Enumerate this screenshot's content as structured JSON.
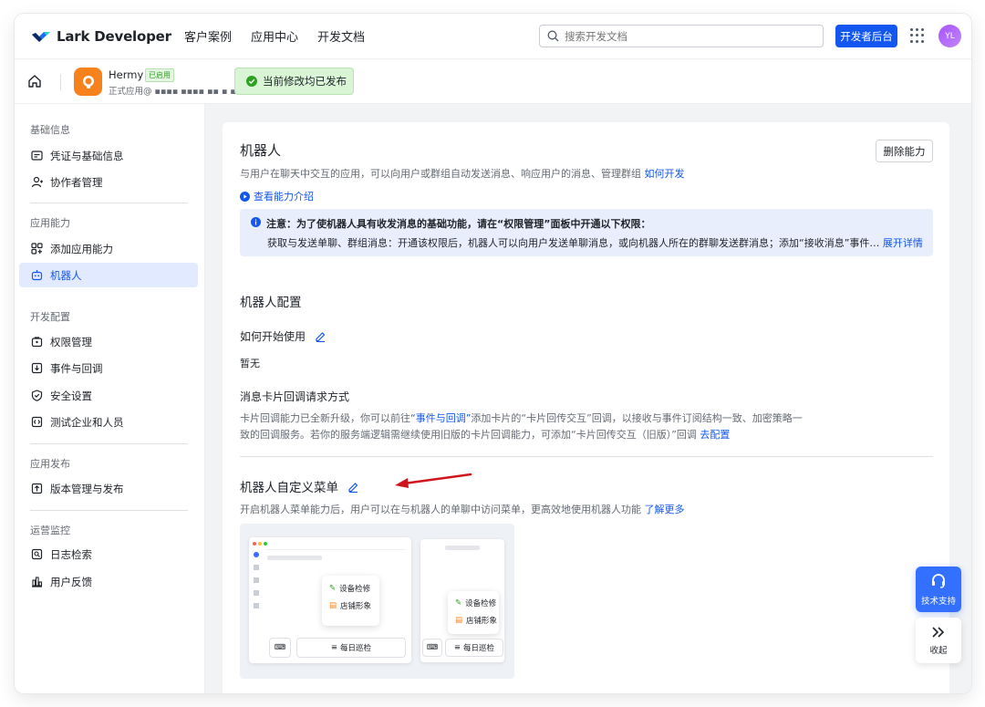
{
  "header": {
    "logo_text": "Lark Developer",
    "nav": [
      "客户案例",
      "应用中心",
      "开发文档"
    ],
    "search_placeholder": "搜索开发文档",
    "dev_console_label": "开发者后台",
    "avatar_initials": "YL"
  },
  "appbar": {
    "app_name": "Hermy",
    "app_status_badge": "已启用",
    "app_subtitle": "正式应用@ ▪▪▪▪ ▪▪▪▪ ▪▪ ▪ ▪▪",
    "publish_status": "当前修改均已发布"
  },
  "sidebar": {
    "sections": [
      {
        "title": "基础信息",
        "items": [
          {
            "label": "凭证与基础信息",
            "icon": "id-card-icon"
          },
          {
            "label": "协作者管理",
            "icon": "user-add-icon"
          }
        ]
      },
      {
        "title": "应用能力",
        "items": [
          {
            "label": "添加应用能力",
            "icon": "add-app-icon"
          },
          {
            "label": "机器人",
            "icon": "robot-icon",
            "active": true
          }
        ]
      },
      {
        "title": "开发配置",
        "items": [
          {
            "label": "权限管理",
            "icon": "permission-icon"
          },
          {
            "label": "事件与回调",
            "icon": "event-icon"
          },
          {
            "label": "安全设置",
            "icon": "shield-icon"
          },
          {
            "label": "测试企业和人员",
            "icon": "test-icon"
          }
        ]
      },
      {
        "title": "应用发布",
        "items": [
          {
            "label": "版本管理与发布",
            "icon": "upload-icon"
          }
        ]
      },
      {
        "title": "运营监控",
        "items": [
          {
            "label": "日志检索",
            "icon": "log-search-icon"
          },
          {
            "label": "用户反馈",
            "icon": "feedback-icon"
          }
        ]
      }
    ]
  },
  "main": {
    "title": "机器人",
    "delete_button": "删除能力",
    "description": "与用户在聊天中交互的应用，可以向用户或群组自动发送消息、响应用户的消息、管理群组",
    "how_to_dev_link": "如何开发",
    "intro_link": "查看能力介绍",
    "notice": {
      "title": "注意：为了使机器人具有收发消息的基础功能，请在“权限管理”面板中开通以下权限：",
      "body": "获取与发送单聊、群组消息：开通该权限后，机器人可以向用户发送单聊消息，或向机器人所在的群聊发送群消息；添加“接收消息”事件…",
      "expand_link": "展开详情"
    },
    "config_title": "机器人配置",
    "how_to_start_title": "如何开始使用",
    "how_to_start_value": "暂无",
    "card_callback_title": "消息卡片回调请求方式",
    "card_callback_line1_a": "卡片回调能力已全新升级，你可以前往",
    "card_callback_line1_link": "“事件与回调”",
    "card_callback_line1_b": "添加卡片的“卡片回传交互”回调，以接收与事件订阅结构一致、加密策略一",
    "card_callback_line2": "致的回调服务。若你的服务端逻辑需继续使用旧版的卡片回调能力，可添加“卡片回传交互（旧版）”回调",
    "card_callback_config_link": "去配置",
    "custom_menu_title": "机器人自定义菜单",
    "custom_menu_desc": "开启机器人菜单能力后，用户可以在与机器人的单聊中访问菜单，更高效地使用机器人功能",
    "learn_more_link": "了解更多",
    "preview": {
      "menu_item_1": "设备检修",
      "menu_item_2": "店铺形象",
      "bottom_button": "每日巡检"
    }
  },
  "floating": {
    "support_label": "技术支持",
    "collapse_label": "收起"
  },
  "colors": {
    "primary": "#1456f0",
    "success_bg": "#d9f5d6",
    "notice_bg": "#e8eefc",
    "annotation_arrow": "#d0141b"
  }
}
